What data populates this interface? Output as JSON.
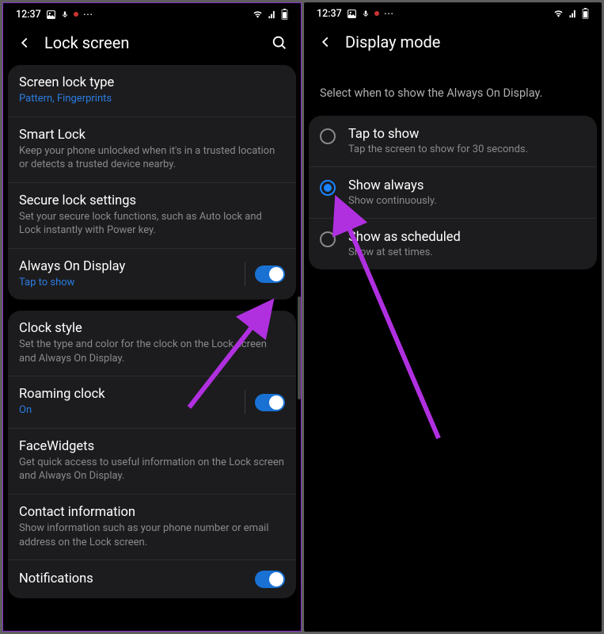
{
  "left": {
    "status": {
      "time": "12:37",
      "dots": "⋯"
    },
    "header": {
      "title": "Lock screen"
    },
    "card1": [
      {
        "title": "Screen lock type",
        "sub": "Pattern, Fingerprints",
        "subClass": "blue"
      },
      {
        "title": "Smart Lock",
        "sub": "Keep your phone unlocked when it's in a trusted location or detects a trusted device nearby."
      },
      {
        "title": "Secure lock settings",
        "sub": "Set your secure lock functions, such as Auto lock and Lock instantly with Power key."
      },
      {
        "title": "Always On Display",
        "sub": "Tap to show",
        "subClass": "blue",
        "switch": true
      }
    ],
    "card2": [
      {
        "title": "Clock style",
        "sub": "Set the type and color for the clock on the Lock screen and Always On Display."
      },
      {
        "title": "Roaming clock",
        "sub": "On",
        "subClass": "blue",
        "switch": true
      },
      {
        "title": "FaceWidgets",
        "sub": "Get quick access to useful information on the Lock screen and Always On Display."
      },
      {
        "title": "Contact information",
        "sub": "Show information such as your phone number or email address on the Lock screen."
      },
      {
        "title": "Notifications",
        "sub": "",
        "switch": true
      }
    ]
  },
  "right": {
    "status": {
      "time": "12:37",
      "dots": "⋯"
    },
    "header": {
      "title": "Display mode"
    },
    "subhead": "Select when to show the Always On Display.",
    "options": [
      {
        "title": "Tap to show",
        "sub": "Tap the screen to show for 30 seconds.",
        "selected": false
      },
      {
        "title": "Show always",
        "sub": "Show continuously.",
        "selected": true
      },
      {
        "title": "Show as scheduled",
        "sub": "Show at set times.",
        "selected": false
      }
    ]
  }
}
